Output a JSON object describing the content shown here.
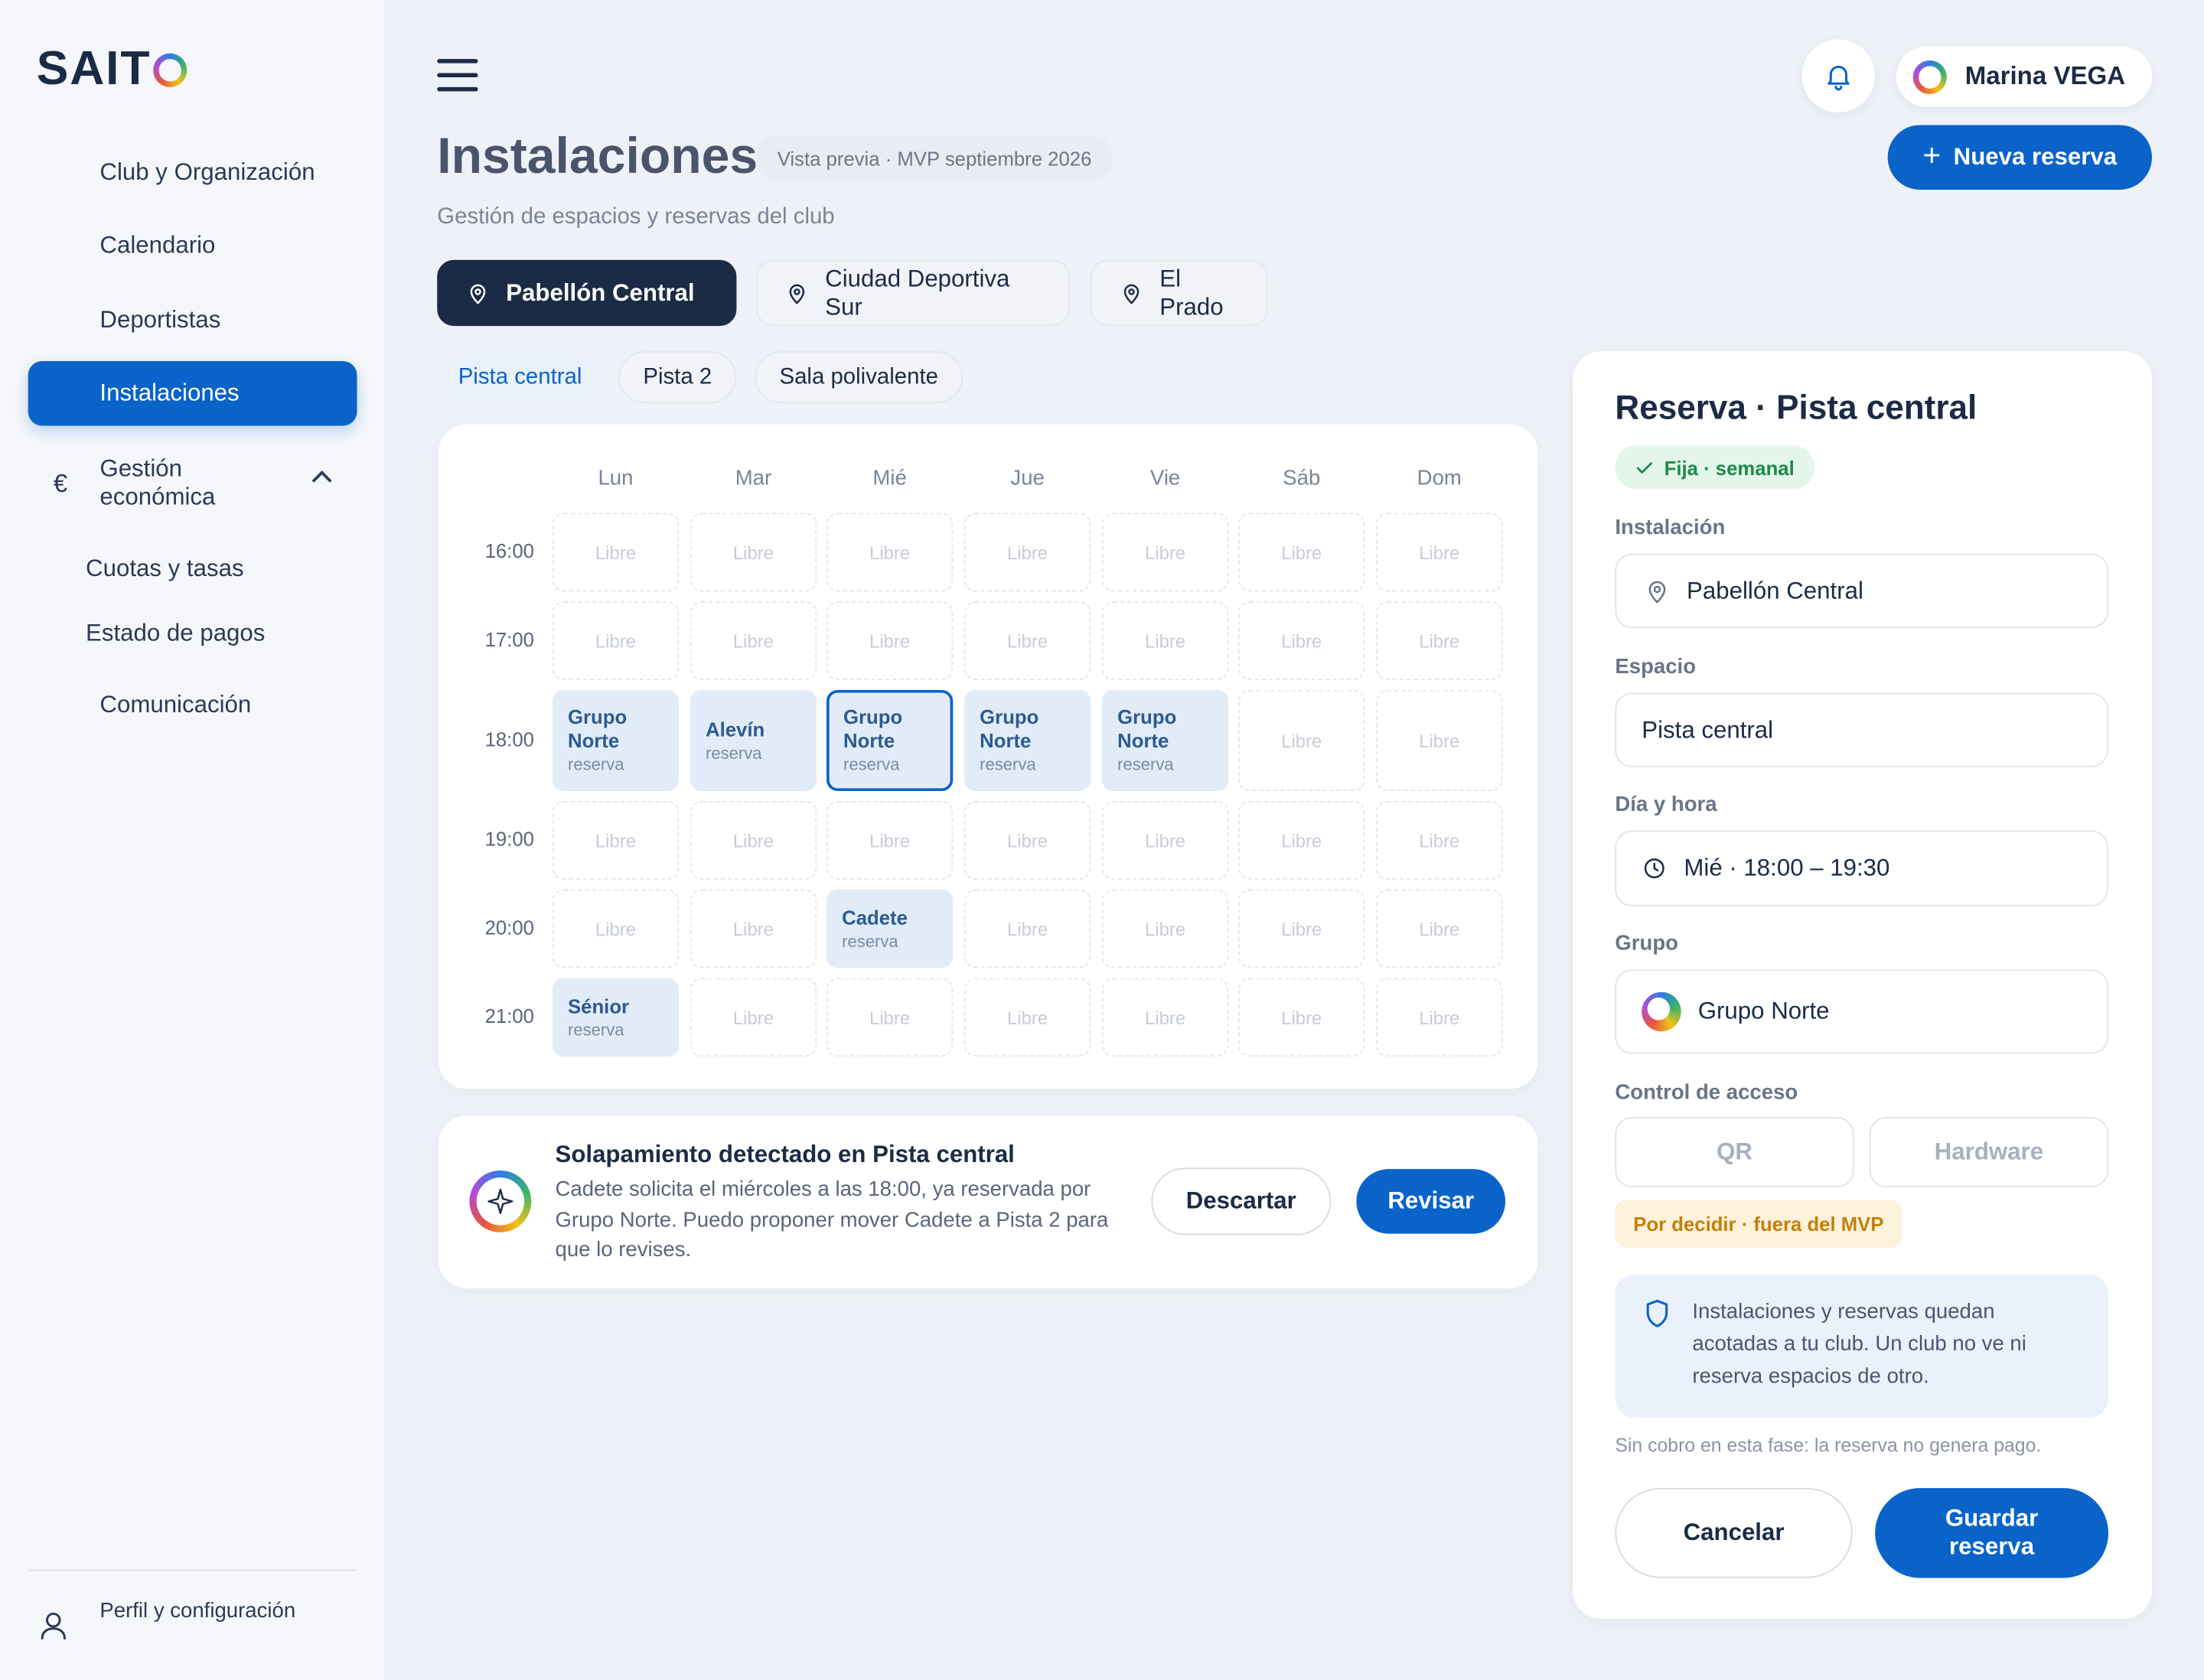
{
  "brand": {
    "name": "SAIT"
  },
  "sidebar": {
    "items": [
      {
        "label": "Club y Organización"
      },
      {
        "label": "Calendario"
      },
      {
        "label": "Deportistas"
      },
      {
        "label": "Instalaciones",
        "active": true
      }
    ],
    "group": {
      "label": "Gestión económica",
      "icon": "euro-icon",
      "expanded": true,
      "children": [
        {
          "label": "Cuotas y tasas"
        },
        {
          "label": "Estado de pagos"
        }
      ]
    },
    "after": [
      {
        "label": "Comunicación"
      }
    ],
    "footer": {
      "label": "Perfil y configuración",
      "icon": "user-icon"
    }
  },
  "topbar": {
    "user_name": "Marina VEGA",
    "bell_icon": "bell-icon",
    "menu_icon": "hamburger-icon"
  },
  "header": {
    "title": "Instalaciones",
    "badge": "Vista previa · MVP septiembre 2026",
    "subtitle": "Gestión de espacios y reservas del club",
    "new_button": "Nueva reserva",
    "new_button_icon": "+"
  },
  "locations": [
    {
      "label": "Pabellón Central",
      "active": true
    },
    {
      "label": "Ciudad Deportiva Sur"
    },
    {
      "label": "El Prado"
    }
  ],
  "spaces": [
    {
      "label": "Pista central",
      "active": true
    },
    {
      "label": "Pista 2"
    },
    {
      "label": "Sala polivalente"
    }
  ],
  "calendar": {
    "days": [
      "Lun",
      "Mar",
      "Mié",
      "Jue",
      "Vie",
      "Sáb",
      "Dom"
    ],
    "hours": [
      "16:00",
      "17:00",
      "18:00",
      "19:00",
      "20:00",
      "21:00"
    ],
    "free_label": "Libre",
    "booking_sub": "reserva",
    "bookings": [
      {
        "day": 0,
        "hour": 2,
        "name": "Grupo Norte"
      },
      {
        "day": 1,
        "hour": 2,
        "name": "Alevín"
      },
      {
        "day": 2,
        "hour": 2,
        "name": "Grupo Norte",
        "selected": true
      },
      {
        "day": 3,
        "hour": 2,
        "name": "Grupo Norte"
      },
      {
        "day": 4,
        "hour": 2,
        "name": "Grupo Norte"
      },
      {
        "day": 2,
        "hour": 4,
        "name": "Cadete"
      },
      {
        "day": 0,
        "hour": 5,
        "name": "Sénior"
      }
    ]
  },
  "alert": {
    "title": "Solapamiento detectado en Pista central",
    "text": "Cadete solicita el miércoles a las 18:00, ya reservada por Grupo Norte. Puedo proponer mover Cadete a Pista 2 para que lo revises.",
    "dismiss": "Descartar",
    "review": "Revisar",
    "icon": "sparkle-icon"
  },
  "panel": {
    "title": "Reserva · Pista central",
    "type_badge": "Fija · semanal",
    "installation_label": "Instalación",
    "installation_value": "Pabellón Central",
    "space_label": "Espacio",
    "space_value": "Pista central",
    "datetime_label": "Día y hora",
    "datetime_value": "Mié · 18:00 – 19:30",
    "group_label": "Grupo",
    "group_value": "Grupo Norte",
    "access_label": "Control de acceso",
    "access_options": [
      "QR",
      "Hardware"
    ],
    "decide_badge": "Por decidir · fuera del MVP",
    "info_text": "Instalaciones y reservas quedan acotadas a tu club. Un club no ve ni reserva espacios de otro.",
    "no_charge": "Sin cobro en esta fase: la reserva no genera pago.",
    "cancel": "Cancelar",
    "save": "Guardar reserva"
  },
  "colors": {
    "accent": "#0a63c9",
    "dark": "#1c2b45",
    "booked_bg": "#e2ecf8",
    "success": "#1d8a48",
    "warning": "#c57f0a"
  }
}
